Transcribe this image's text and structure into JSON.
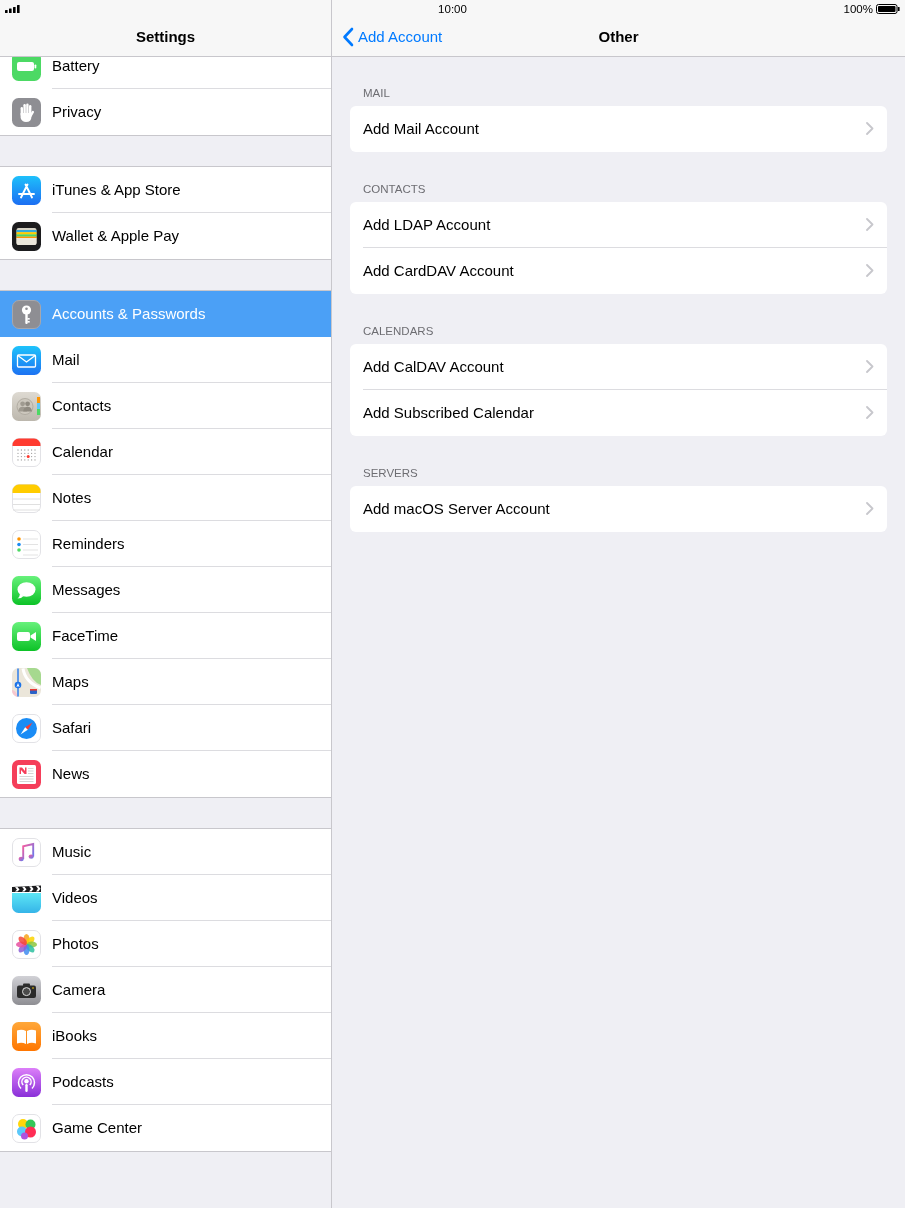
{
  "status_bar": {
    "time": "10:00",
    "battery": "100%"
  },
  "sidebar": {
    "title": "Settings",
    "groups": [
      {
        "items": [
          {
            "label": "Battery",
            "selected": false
          },
          {
            "label": "Privacy",
            "selected": false
          }
        ]
      },
      {
        "items": [
          {
            "label": "iTunes & App Store",
            "selected": false
          },
          {
            "label": "Wallet & Apple Pay",
            "selected": false
          }
        ]
      },
      {
        "items": [
          {
            "label": "Accounts & Passwords",
            "selected": true
          },
          {
            "label": "Mail",
            "selected": false
          },
          {
            "label": "Contacts",
            "selected": false
          },
          {
            "label": "Calendar",
            "selected": false
          },
          {
            "label": "Notes",
            "selected": false
          },
          {
            "label": "Reminders",
            "selected": false
          },
          {
            "label": "Messages",
            "selected": false
          },
          {
            "label": "FaceTime",
            "selected": false
          },
          {
            "label": "Maps",
            "selected": false
          },
          {
            "label": "Safari",
            "selected": false
          },
          {
            "label": "News",
            "selected": false
          }
        ]
      },
      {
        "items": [
          {
            "label": "Music",
            "selected": false
          },
          {
            "label": "Videos",
            "selected": false
          },
          {
            "label": "Photos",
            "selected": false
          },
          {
            "label": "Camera",
            "selected": false
          },
          {
            "label": "iBooks",
            "selected": false
          },
          {
            "label": "Podcasts",
            "selected": false
          },
          {
            "label": "Game Center",
            "selected": false
          }
        ]
      }
    ]
  },
  "detail": {
    "back_button": "Add Account",
    "title": "Other",
    "sections": [
      {
        "header": "MAIL",
        "rows": [
          "Add Mail Account"
        ]
      },
      {
        "header": "CONTACTS",
        "rows": [
          "Add LDAP Account",
          "Add CardDAV Account"
        ]
      },
      {
        "header": "CALENDARS",
        "rows": [
          "Add CalDAV Account",
          "Add Subscribed Calendar"
        ]
      },
      {
        "header": "SERVERS",
        "rows": [
          "Add macOS Server Account"
        ]
      }
    ]
  }
}
